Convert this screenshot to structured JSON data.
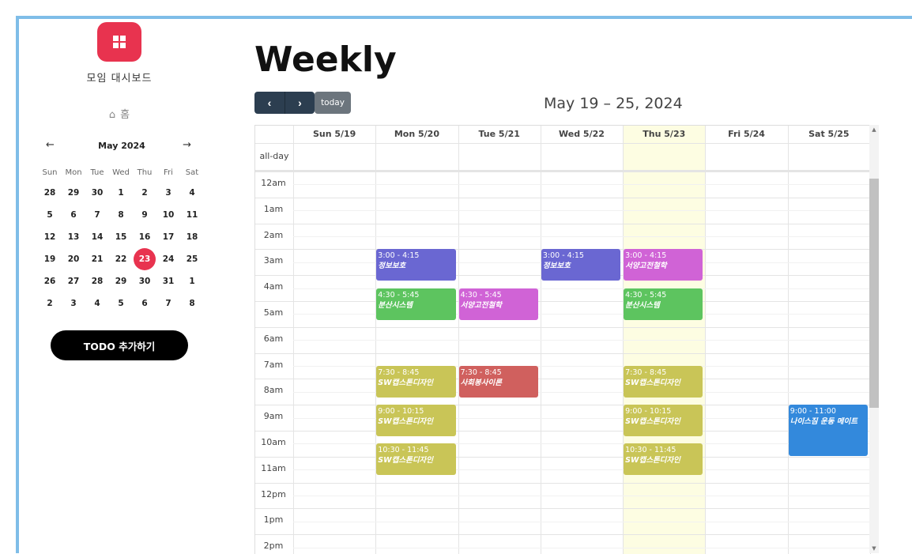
{
  "sidebar": {
    "logo_icon": "dashboard-grid-icon",
    "app_title": "모임 대시보드",
    "home_icon": "home-icon",
    "home_label": "홈",
    "mini_calendar": {
      "title": "May 2024",
      "prev": "←",
      "next": "→",
      "weekdays": [
        "Sun",
        "Mon",
        "Tue",
        "Wed",
        "Thu",
        "Fri",
        "Sat"
      ],
      "weeks": [
        [
          "28",
          "29",
          "30",
          "1",
          "2",
          "3",
          "4"
        ],
        [
          "5",
          "6",
          "7",
          "8",
          "9",
          "10",
          "11"
        ],
        [
          "12",
          "13",
          "14",
          "15",
          "16",
          "17",
          "18"
        ],
        [
          "19",
          "20",
          "21",
          "22",
          "23",
          "24",
          "25"
        ],
        [
          "26",
          "27",
          "28",
          "29",
          "30",
          "31",
          "1"
        ],
        [
          "2",
          "3",
          "4",
          "5",
          "6",
          "7",
          "8"
        ]
      ],
      "selected": "23"
    },
    "todo_button": "TODO 추가하기"
  },
  "main": {
    "title": "Weekly",
    "prev_label": "‹",
    "next_label": "›",
    "today_label": "today",
    "range_title": "May 19 – 25, 2024",
    "allday_label": "all-day",
    "columns": [
      "Sun 5/19",
      "Mon 5/20",
      "Tue 5/21",
      "Wed 5/22",
      "Thu 5/23",
      "Fri 5/24",
      "Sat 5/25"
    ],
    "today_column": 4,
    "hours": [
      "12am",
      "1am",
      "2am",
      "3am",
      "4am",
      "5am",
      "6am",
      "7am",
      "8am",
      "9am",
      "10am",
      "11am",
      "12pm",
      "1pm",
      "2pm"
    ],
    "events": [
      {
        "day": 1,
        "start": 3.0,
        "end": 4.25,
        "time": "3:00 - 4:15",
        "title": "정보보호",
        "color": "#6a67d2"
      },
      {
        "day": 3,
        "start": 3.0,
        "end": 4.25,
        "time": "3:00 - 4:15",
        "title": "정보보호",
        "color": "#6a67d2"
      },
      {
        "day": 4,
        "start": 3.0,
        "end": 4.25,
        "time": "3:00 - 4:15",
        "title": "서양고전철학",
        "color": "#d063d6"
      },
      {
        "day": 1,
        "start": 4.5,
        "end": 5.75,
        "time": "4:30 - 5:45",
        "title": "분산시스템",
        "color": "#5dc45f"
      },
      {
        "day": 2,
        "start": 4.5,
        "end": 5.75,
        "time": "4:30 - 5:45",
        "title": "서양고전철학",
        "color": "#d063d6"
      },
      {
        "day": 4,
        "start": 4.5,
        "end": 5.75,
        "time": "4:30 - 5:45",
        "title": "분산시스템",
        "color": "#5dc45f"
      },
      {
        "day": 1,
        "start": 7.5,
        "end": 8.75,
        "time": "7:30 - 8:45",
        "title": "SW캡스톤디자인",
        "color": "#c9c557"
      },
      {
        "day": 2,
        "start": 7.5,
        "end": 8.75,
        "time": "7:30 - 8:45",
        "title": "사회봉사이론",
        "color": "#d0605e"
      },
      {
        "day": 4,
        "start": 7.5,
        "end": 8.75,
        "time": "7:30 - 8:45",
        "title": "SW캡스톤디자인",
        "color": "#c9c557"
      },
      {
        "day": 1,
        "start": 9.0,
        "end": 10.25,
        "time": "9:00 - 10:15",
        "title": "SW캡스톤디자인",
        "color": "#c9c557"
      },
      {
        "day": 4,
        "start": 9.0,
        "end": 10.25,
        "time": "9:00 - 10:15",
        "title": "SW캡스톤디자인",
        "color": "#c9c557"
      },
      {
        "day": 6,
        "start": 9.0,
        "end": 11.0,
        "time": "9:00 - 11:00",
        "title": "나이스짐 운동 메이트",
        "color": "#3389dc"
      },
      {
        "day": 1,
        "start": 10.5,
        "end": 11.75,
        "time": "10:30 - 11:45",
        "title": "SW캡스톤디자인",
        "color": "#c9c557"
      },
      {
        "day": 4,
        "start": 10.5,
        "end": 11.75,
        "time": "10:30 - 11:45",
        "title": "SW캡스톤디자인",
        "color": "#c9c557"
      }
    ]
  }
}
